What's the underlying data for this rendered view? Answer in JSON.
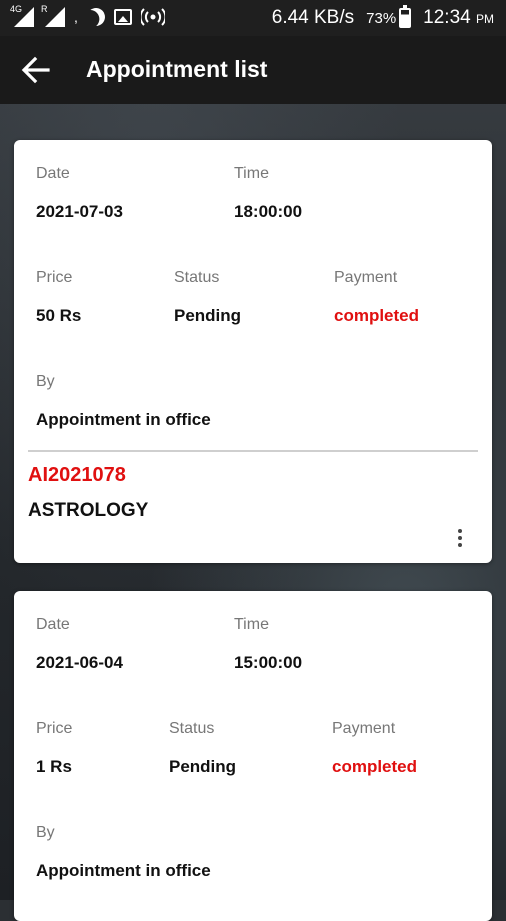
{
  "status_bar": {
    "net1": "4G",
    "net2": "R",
    "speed": "6.44 KB/s",
    "battery": "73%",
    "time": "12:34",
    "ampm": "PM"
  },
  "app_bar": {
    "title": "Appointment list"
  },
  "labels": {
    "date": "Date",
    "time": "Time",
    "price": "Price",
    "status": "Status",
    "payment": "Payment",
    "by": "By"
  },
  "appointments": [
    {
      "date": "2021-07-03",
      "time": "18:00:00",
      "price": "50 Rs",
      "status": "Pending",
      "payment": "completed",
      "by": "Appointment in office",
      "code": "AI2021078",
      "service": "ASTROLOGY"
    },
    {
      "date": "2021-06-04",
      "time": "15:00:00",
      "price": "1 Rs",
      "status": "Pending",
      "payment": "completed",
      "by": "Appointment in office"
    }
  ],
  "colors": {
    "accent_red": "#e01010",
    "appbar": "#1a1a1a"
  }
}
